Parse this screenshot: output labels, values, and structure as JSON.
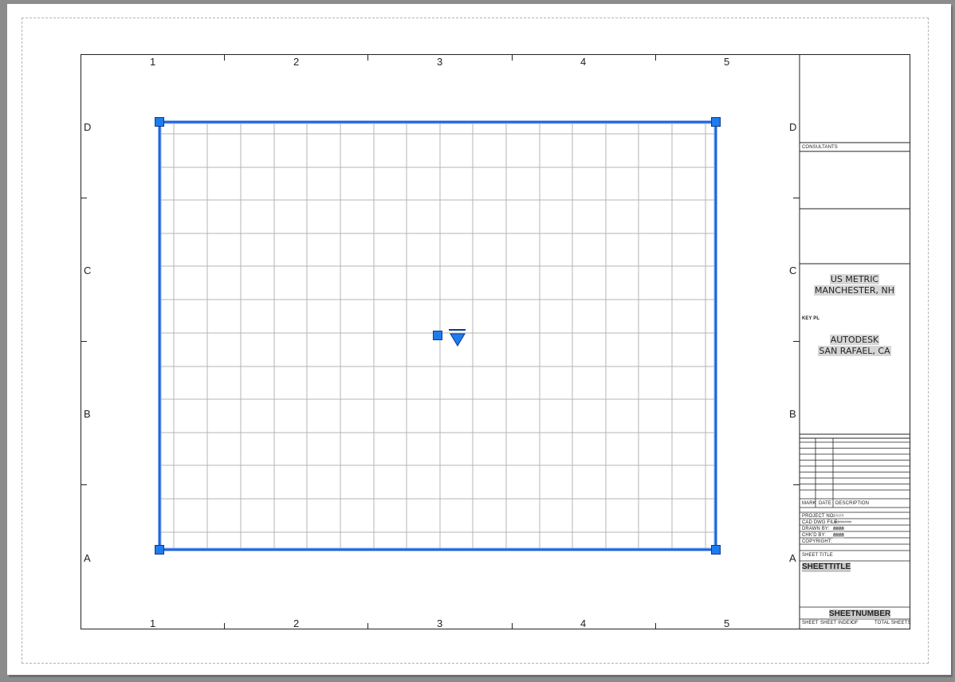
{
  "zones": {
    "columns": [
      "1",
      "2",
      "3",
      "4",
      "5"
    ],
    "rows": [
      "D",
      "C",
      "B",
      "A"
    ]
  },
  "title_block": {
    "consultants_label": "CONSULTANTS",
    "company_name": "US METRIC",
    "company_location": "MANCHESTER, NH",
    "client_name": "AUTODESK",
    "client_location": "SAN RAFAEL, CA",
    "key_plan_label": "KEY PL",
    "revisions_headers": [
      "MARK",
      "DATE",
      "DESCRIPTION"
    ],
    "project_no_label": "PROJECT NO:",
    "project_no_value": "####",
    "cad_file_label": "CAD DWG FILE:",
    "cad_file_value": "##########",
    "drawn_by_label": "DRAWN BY:",
    "drawn_by_value": "####",
    "checked_by_label": "CHK'D BY:",
    "checked_by_value": "####",
    "copyright_label": "COPYRIGHT:",
    "sheet_title_label": "SHEET TITLE",
    "sheet_title_value": "SHEETTITLE",
    "sheet_number_value": "SHEETNUMBER",
    "sheet_label": "SHEET",
    "sheet_index_label": "SHEET INDEX",
    "of_label": "OF",
    "total_sheets_label": "TOTAL SHEETS"
  },
  "colors": {
    "viewport_border": "#1e64dc",
    "grip": "#1e7cf0",
    "grid": "#b4b4b4",
    "background": "#8c8c8c"
  },
  "icons": {
    "viewport_center_grip": "square-grip-icon",
    "lookup_grip": "triangle-lookup-grip-icon"
  }
}
